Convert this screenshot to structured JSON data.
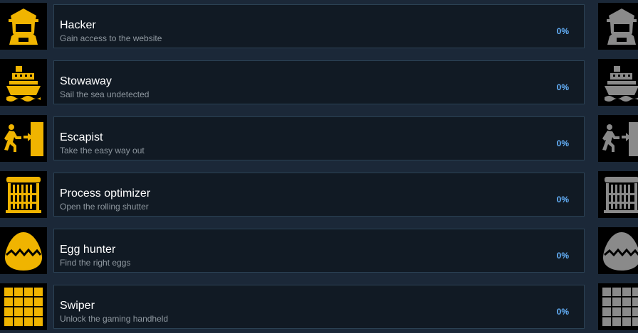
{
  "colors": {
    "unlocked_icon": "#f0b400",
    "locked_icon": "#8a8a8a",
    "percent": "#66b4ff"
  },
  "achievements": [
    {
      "title": "Hacker",
      "description": "Gain access to the website",
      "percent": "0%",
      "icon": "hooded-hacker-icon"
    },
    {
      "title": "Stowaway",
      "description": "Sail the sea undetected",
      "percent": "0%",
      "icon": "ship-icon"
    },
    {
      "title": "Escapist",
      "description": "Take the easy way out",
      "percent": "0%",
      "icon": "exit-door-icon"
    },
    {
      "title": "Process optimizer",
      "description": "Open the rolling shutter",
      "percent": "0%",
      "icon": "rolling-shutter-icon"
    },
    {
      "title": "Egg hunter",
      "description": "Find the right eggs",
      "percent": "0%",
      "icon": "egg-icon"
    },
    {
      "title": "Swiper",
      "description": "Unlock the gaming handheld",
      "percent": "0%",
      "icon": "grid-icon"
    }
  ]
}
